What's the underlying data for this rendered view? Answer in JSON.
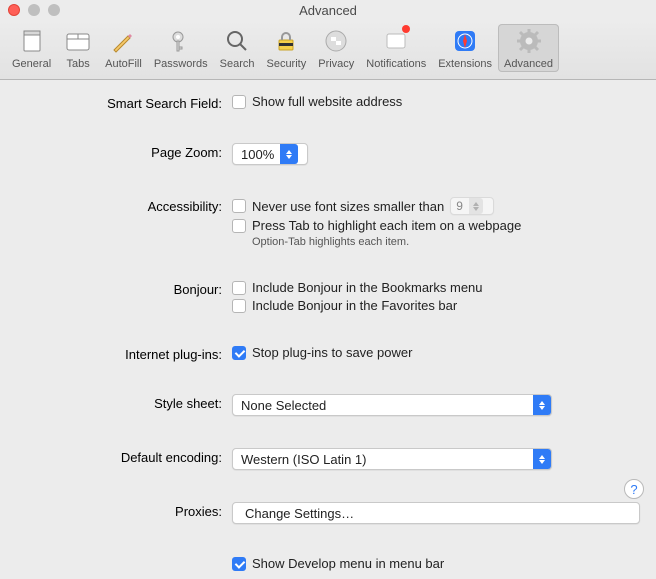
{
  "window": {
    "title": "Advanced"
  },
  "toolbar": {
    "items": [
      {
        "label": "General"
      },
      {
        "label": "Tabs"
      },
      {
        "label": "AutoFill"
      },
      {
        "label": "Passwords"
      },
      {
        "label": "Search"
      },
      {
        "label": "Security"
      },
      {
        "label": "Privacy"
      },
      {
        "label": "Notifications"
      },
      {
        "label": "Extensions"
      },
      {
        "label": "Advanced"
      }
    ]
  },
  "labels": {
    "smart_search": "Smart Search Field:",
    "page_zoom": "Page Zoom:",
    "accessibility": "Accessibility:",
    "bonjour": "Bonjour:",
    "plugins": "Internet plug-ins:",
    "stylesheet": "Style sheet:",
    "encoding": "Default encoding:",
    "proxies": "Proxies:"
  },
  "fields": {
    "show_full_url": "Show full website address",
    "zoom_value": "100%",
    "min_font": "Never use font sizes smaller than",
    "min_font_value": "9",
    "press_tab": "Press Tab to highlight each item on a webpage",
    "press_tab_note": "Option-Tab highlights each item.",
    "bonjour_bookmarks": "Include Bonjour in the Bookmarks menu",
    "bonjour_favorites": "Include Bonjour in the Favorites bar",
    "stop_plugins": "Stop plug-ins to save power",
    "stylesheet_value": "None Selected",
    "encoding_value": "Western (ISO Latin 1)",
    "change_settings": "Change Settings…",
    "show_develop": "Show Develop menu in menu bar"
  }
}
